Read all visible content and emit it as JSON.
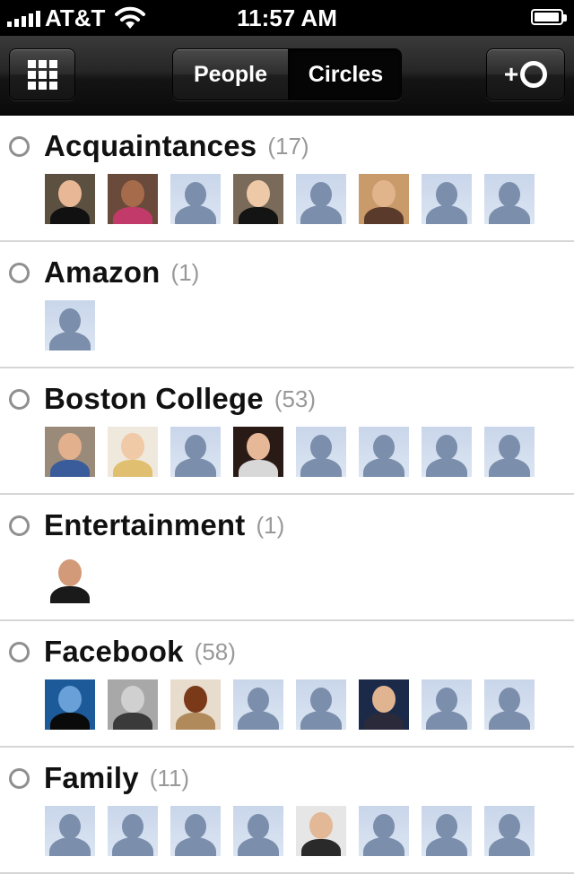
{
  "status_bar": {
    "carrier": "AT&T",
    "time": "11:57 AM",
    "signal_bars": 5,
    "battery_level": 0.95
  },
  "nav": {
    "grid_icon": "grid-icon",
    "segments": [
      {
        "label": "People",
        "selected": false
      },
      {
        "label": "Circles",
        "selected": true
      }
    ],
    "add_label": "+",
    "add_icon": "circle-ring-icon"
  },
  "circles": [
    {
      "name": "Acquaintances",
      "count": "(17)",
      "avatars": [
        {
          "kind": "photo",
          "bg": "#5c5040",
          "face": "#e8b896",
          "shirt": "#111111"
        },
        {
          "kind": "photo",
          "bg": "#6a4a3a",
          "face": "#a56b4a",
          "shirt": "#c23a6a"
        },
        {
          "kind": "default"
        },
        {
          "kind": "photo",
          "bg": "#7a6a5a",
          "face": "#eec9a8",
          "shirt": "#141414"
        },
        {
          "kind": "default"
        },
        {
          "kind": "photo",
          "bg": "#c99a6a",
          "face": "#e2b48c",
          "shirt": "#5a3a2a"
        },
        {
          "kind": "default"
        },
        {
          "kind": "default"
        }
      ]
    },
    {
      "name": "Amazon",
      "count": "(1)",
      "avatars": [
        {
          "kind": "default"
        }
      ]
    },
    {
      "name": "Boston College",
      "count": "(53)",
      "avatars": [
        {
          "kind": "photo",
          "bg": "#9a8a7a",
          "face": "#e3b08e",
          "shirt": "#3b5c9a"
        },
        {
          "kind": "photo",
          "bg": "#efe8dc",
          "face": "#f0c9a6",
          "shirt": "#e0c070"
        },
        {
          "kind": "default"
        },
        {
          "kind": "photo",
          "bg": "#2a1a16",
          "face": "#e6b898",
          "shirt": "#d8d8d8"
        },
        {
          "kind": "default"
        },
        {
          "kind": "default"
        },
        {
          "kind": "default"
        },
        {
          "kind": "default"
        }
      ]
    },
    {
      "name": "Entertainment",
      "count": "(1)",
      "avatars": [
        {
          "kind": "photo",
          "bg": "#ffffff",
          "face": "#d29a78",
          "shirt": "#1a1a1a"
        }
      ]
    },
    {
      "name": "Facebook",
      "count": "(58)",
      "avatars": [
        {
          "kind": "photo",
          "bg": "#1c5a9a",
          "face": "#6aa0d8",
          "shirt": "#0a0a0a"
        },
        {
          "kind": "photo",
          "bg": "#a8a8a8",
          "face": "#d0d0d0",
          "shirt": "#3a3a3a"
        },
        {
          "kind": "photo",
          "bg": "#e8dccc",
          "face": "#7a3a1a",
          "shirt": "#b08a5a"
        },
        {
          "kind": "default"
        },
        {
          "kind": "default"
        },
        {
          "kind": "photo",
          "bg": "#1c2a4a",
          "face": "#e0b490",
          "shirt": "#2a2a3a"
        },
        {
          "kind": "default"
        },
        {
          "kind": "default"
        }
      ]
    },
    {
      "name": "Family",
      "count": "(11)",
      "avatars": [
        {
          "kind": "default"
        },
        {
          "kind": "default"
        },
        {
          "kind": "default"
        },
        {
          "kind": "default"
        },
        {
          "kind": "photo",
          "bg": "#e6e6e6",
          "face": "#e2b896",
          "shirt": "#2a2a2a"
        },
        {
          "kind": "default"
        },
        {
          "kind": "default"
        },
        {
          "kind": "default"
        }
      ]
    }
  ]
}
